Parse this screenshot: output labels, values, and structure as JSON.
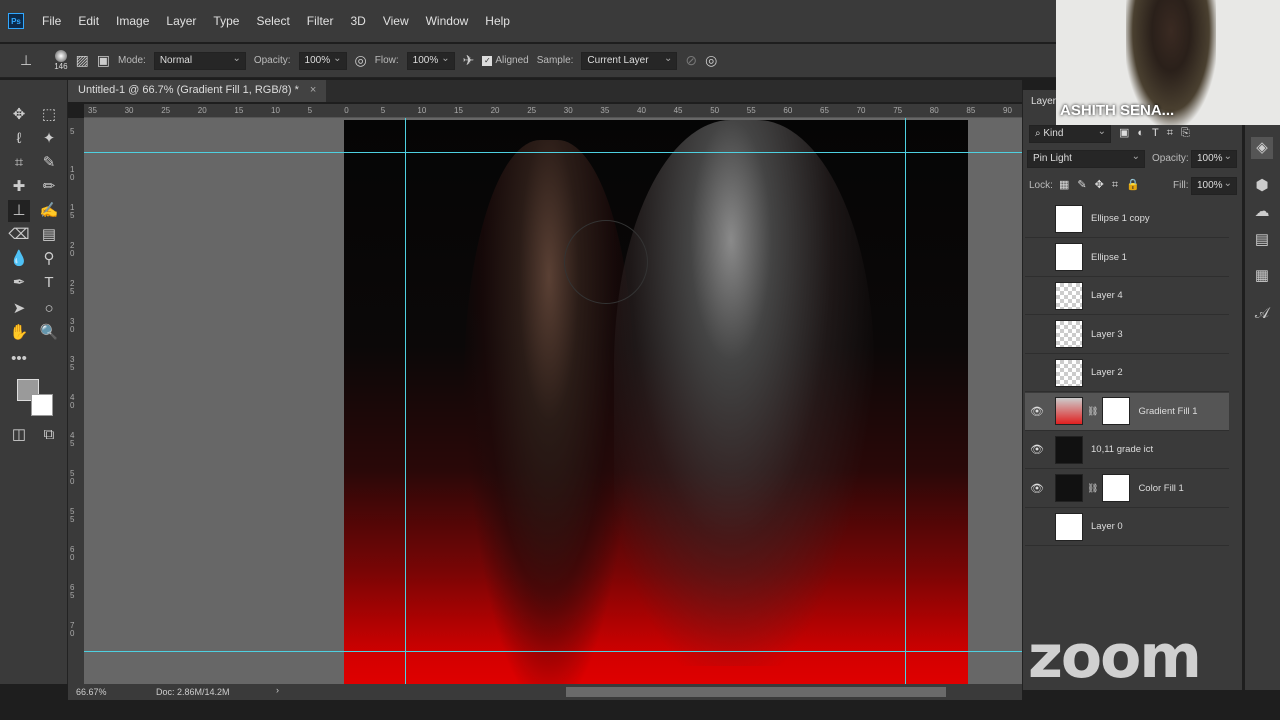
{
  "menu": {
    "logo": "Ps",
    "items": [
      "File",
      "Edit",
      "Image",
      "Layer",
      "Type",
      "Select",
      "Filter",
      "3D",
      "View",
      "Window",
      "Help"
    ]
  },
  "options": {
    "brush_size": "146",
    "mode_label": "Mode:",
    "mode": "Normal",
    "opacity_label": "Opacity:",
    "opacity": "100%",
    "flow_label": "Flow:",
    "flow": "100%",
    "aligned_label": "Aligned",
    "aligned": true,
    "sample_label": "Sample:",
    "sample": "Current Layer"
  },
  "document": {
    "tab_title": "Untitled-1 @ 66.7% (Gradient Fill 1, RGB/8) *",
    "close": "×"
  },
  "ruler": {
    "h_ticks": [
      "35",
      "30",
      "25",
      "20",
      "15",
      "10",
      "5",
      "0",
      "5",
      "10",
      "15",
      "20",
      "25",
      "30",
      "35",
      "40",
      "45",
      "50",
      "55",
      "60",
      "65",
      "70",
      "75",
      "80",
      "85",
      "90"
    ],
    "v_ticks": [
      "5",
      "1 0",
      "1 5",
      "2 0",
      "2 5",
      "3 0",
      "3 5",
      "4 0",
      "4 5",
      "5 0",
      "5 5",
      "6 0",
      "6 5",
      "7 0"
    ]
  },
  "status": {
    "zoom": "66.67%",
    "doc": "Doc: 2.86M/14.2M"
  },
  "layers_panel": {
    "title": "Layers",
    "filter": "Kind",
    "blend_mode": "Pin Light",
    "opacity_label": "Opacity:",
    "opacity": "100%",
    "lock_label": "Lock:",
    "fill_label": "Fill:",
    "fill": "100%",
    "layers": [
      {
        "name": "Ellipse 1 copy",
        "visible": false
      },
      {
        "name": "Ellipse 1",
        "visible": false
      },
      {
        "name": "Layer 4",
        "visible": false
      },
      {
        "name": "Layer 3",
        "visible": false
      },
      {
        "name": "Layer 2",
        "visible": false
      },
      {
        "name": "Gradient Fill 1",
        "visible": true,
        "selected": true
      },
      {
        "name": "10,11 grade ict",
        "visible": true
      },
      {
        "name": "Color Fill 1",
        "visible": true
      },
      {
        "name": "Layer 0",
        "visible": false
      }
    ]
  },
  "webcam": {
    "participant": "ASHITH SENA..."
  },
  "overlay": {
    "zoom_watermark": "zoom"
  },
  "colors": {
    "accent": "#31a8ff",
    "guide": "#4ed0e0",
    "gradient_red": "#e00000"
  }
}
